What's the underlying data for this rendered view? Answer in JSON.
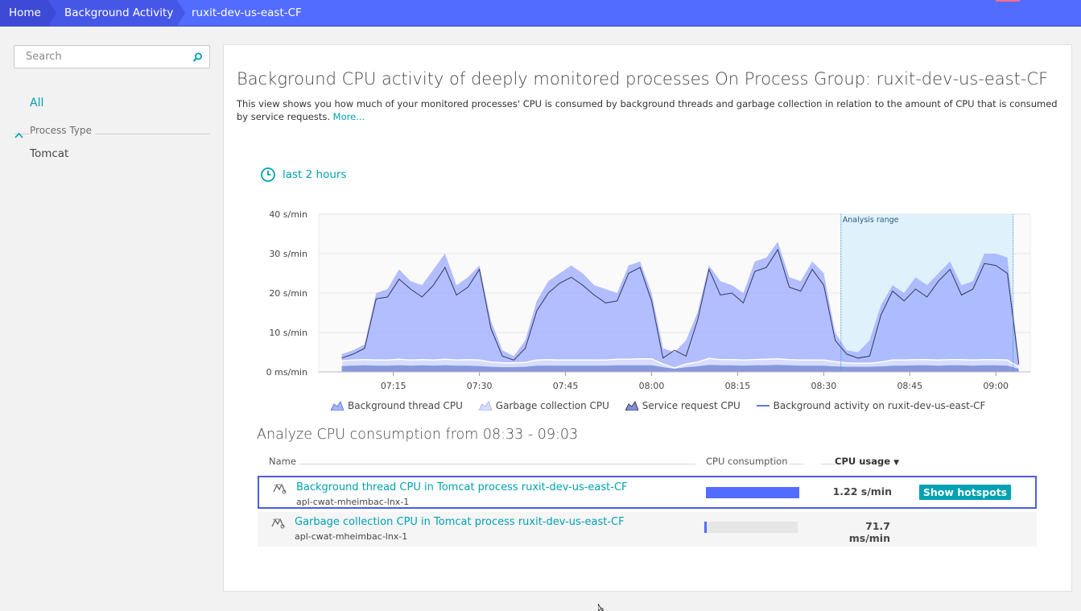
{
  "breadcrumb": {
    "home": "Home",
    "background_activity": "Background Activity",
    "current": "ruxit-dev-us-east-CF"
  },
  "sidebar": {
    "search_placeholder": "Search",
    "all_label": "All",
    "group_label": "Process Type",
    "items": [
      {
        "label": "Tomcat"
      }
    ]
  },
  "main": {
    "title": "Background CPU activity of deeply monitored processes On Process Group: ruxit-dev-us-east-CF",
    "description": "This view shows you how much of your monitored processes' CPU is consumed by background threads and garbage collection in relation to the amount of CPU that is consumed by service requests.",
    "more_link": "More...",
    "timeframe": "last 2 hours"
  },
  "chart_data": {
    "type": "area",
    "y_ticks": [
      "40 s/min",
      "30 s/min",
      "20 s/min",
      "10 s/min",
      "0 ms/min"
    ],
    "ylim": [
      0,
      40
    ],
    "x_ticks": [
      "07:15",
      "07:30",
      "07:45",
      "08:00",
      "08:15",
      "08:30",
      "08:45",
      "09:00"
    ],
    "x": [
      "07:06",
      "07:08",
      "07:10",
      "07:12",
      "07:14",
      "07:16",
      "07:18",
      "07:20",
      "07:22",
      "07:24",
      "07:26",
      "07:28",
      "07:30",
      "07:32",
      "07:34",
      "07:36",
      "07:38",
      "07:40",
      "07:42",
      "07:44",
      "07:46",
      "07:48",
      "07:50",
      "07:52",
      "07:54",
      "07:56",
      "07:58",
      "08:00",
      "08:02",
      "08:04",
      "08:06",
      "08:08",
      "08:10",
      "08:12",
      "08:14",
      "08:16",
      "08:18",
      "08:20",
      "08:22",
      "08:24",
      "08:26",
      "08:28",
      "08:30",
      "08:32",
      "08:34",
      "08:36",
      "08:38",
      "08:40",
      "08:42",
      "08:44",
      "08:46",
      "08:48",
      "08:50",
      "08:52",
      "08:54",
      "08:56",
      "08:58",
      "09:00",
      "09:02",
      "09:04"
    ],
    "series": [
      {
        "name": "Background thread CPU",
        "color": "#a4b3ff",
        "values": [
          4.5,
          5.5,
          7,
          20,
          21,
          26,
          23,
          22,
          26,
          30,
          22,
          24,
          27,
          13,
          5.5,
          4,
          8,
          18,
          23,
          25,
          27,
          25,
          22,
          21,
          20,
          27,
          28,
          20,
          6,
          5,
          8,
          15,
          27,
          23,
          22,
          20,
          28,
          29,
          33,
          24,
          23,
          28,
          25,
          10,
          5.5,
          5,
          8,
          17,
          22,
          20,
          24,
          22,
          25,
          28,
          22,
          23,
          30,
          30,
          29,
          3
        ]
      },
      {
        "name": "Garbage collection CPU",
        "color": "#d6ddff",
        "values": [
          2.8,
          3,
          3.1,
          3,
          3,
          3.2,
          3,
          3.1,
          3,
          3.2,
          3,
          3.1,
          3,
          2.5,
          2.3,
          2.3,
          2.4,
          3,
          3.1,
          3,
          3,
          3,
          3,
          3,
          3.2,
          3.2,
          3.3,
          3.3,
          2,
          1,
          2,
          2.5,
          3.4,
          3.1,
          3.1,
          3,
          3.1,
          3.2,
          3.3,
          3.1,
          3,
          3,
          3,
          2.6,
          2.3,
          2.2,
          2.2,
          2.5,
          3,
          3,
          3.1,
          3.1,
          3,
          3.1,
          3.1,
          3,
          3.1,
          3.1,
          3,
          1.2
        ]
      },
      {
        "name": "Service request CPU",
        "color": "#8090d9",
        "values": [
          1.5,
          1.6,
          1.7,
          1.6,
          1.6,
          1.7,
          1.6,
          1.7,
          1.6,
          1.7,
          1.6,
          1.6,
          1.5,
          1.3,
          1.2,
          1.2,
          1.3,
          1.6,
          1.6,
          1.6,
          1.6,
          1.6,
          1.6,
          1.6,
          1.7,
          1.7,
          1.7,
          1.7,
          1.2,
          0.8,
          1.2,
          1.4,
          1.8,
          1.7,
          1.7,
          1.6,
          1.7,
          1.7,
          1.8,
          1.7,
          1.6,
          1.6,
          1.6,
          1.4,
          1.3,
          1.3,
          1.3,
          1.4,
          1.6,
          1.6,
          1.7,
          1.7,
          1.6,
          1.7,
          1.7,
          1.6,
          1.7,
          1.7,
          1.6,
          0.8
        ]
      },
      {
        "name": "Background activity on ruxit-dev-us-east-CF",
        "color": "#33395c",
        "values": [
          3.5,
          4.5,
          6,
          18.5,
          19,
          23.5,
          21,
          19,
          22,
          26.5,
          19.5,
          21.5,
          26,
          11,
          4,
          3,
          6,
          15.5,
          20,
          22.5,
          24,
          22,
          19.5,
          17.5,
          18,
          25,
          26.5,
          18,
          3.5,
          5.5,
          4,
          13,
          26,
          19.5,
          20,
          17.5,
          25.5,
          26.5,
          31,
          21.5,
          20.5,
          26,
          22,
          8,
          4.5,
          3.5,
          4,
          14.5,
          20.5,
          18,
          21,
          19,
          23,
          26,
          19.5,
          21,
          27.5,
          27,
          25,
          2
        ]
      }
    ],
    "analysis_range": {
      "label": "Analysis range",
      "from": "08:33",
      "to": "09:03"
    },
    "legend": [
      {
        "label": "Background thread CPU",
        "icon": "area-icon"
      },
      {
        "label": "Garbage collection CPU",
        "icon": "area-icon"
      },
      {
        "label": "Service request CPU",
        "icon": "area-icon"
      },
      {
        "label": "Background activity on ruxit-dev-us-east-CF",
        "icon": "line-icon"
      }
    ]
  },
  "analysis": {
    "title": "Analyze CPU consumption from 08:33 - 09:03",
    "columns": {
      "name": "Name",
      "cpu_consumption": "CPU consumption",
      "cpu_usage": "CPU usage",
      "sort_indicator": "▼"
    },
    "rows": [
      {
        "name": "Background thread CPU in Tomcat process ruxit-dev-us-east-CF",
        "host": "apl-cwat-mheimbac-lnx-1",
        "consumption_fraction": 1.0,
        "usage": "1.22 s/min",
        "action": "Show hotspots"
      },
      {
        "name": "Garbage collection CPU in Tomcat process ruxit-dev-us-east-CF",
        "host": "apl-cwat-mheimbac-lnx-1",
        "consumption_fraction": 0.03,
        "usage": "71.7 ms/min"
      }
    ]
  },
  "colors": {
    "accent": "#00a1b2",
    "topbar": "#526cff",
    "selection_border": "#4c5ee0"
  }
}
